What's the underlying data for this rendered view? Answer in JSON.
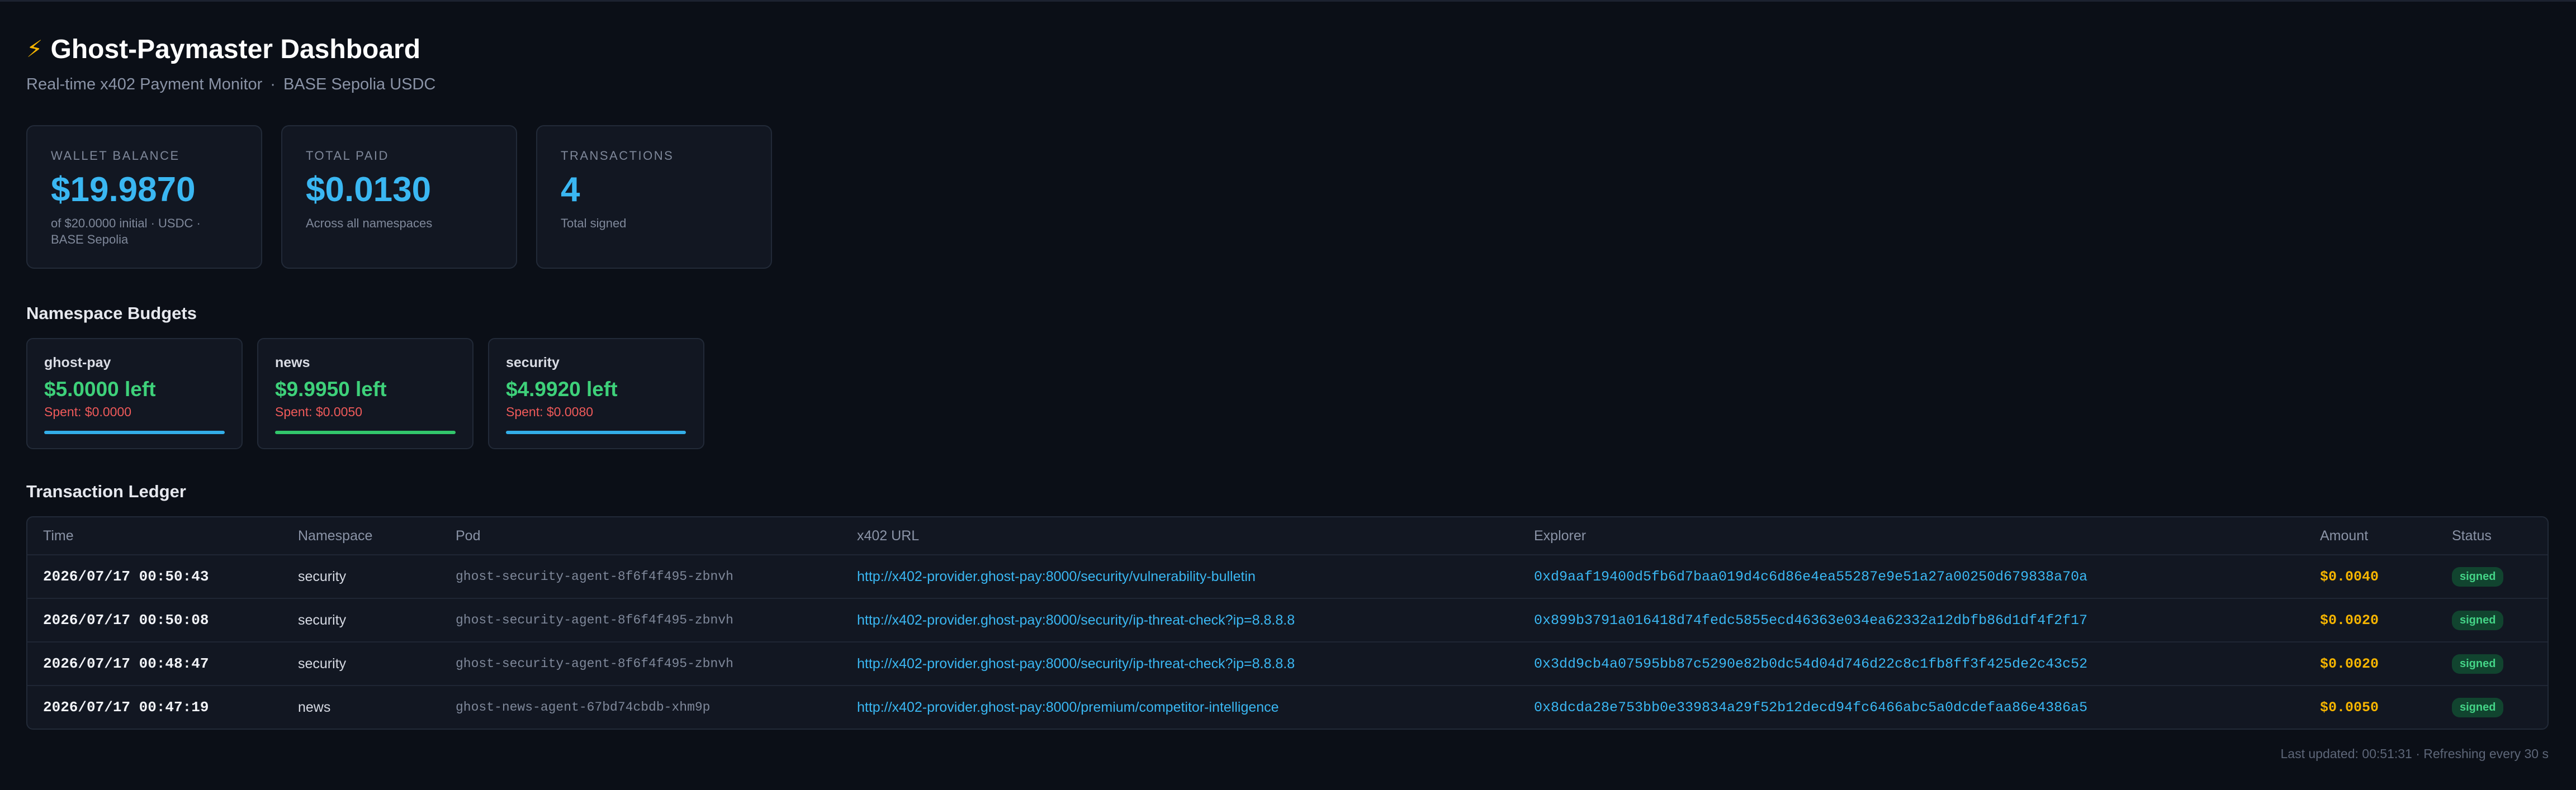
{
  "header": {
    "title": "Ghost-Paymaster Dashboard",
    "subtitle_left": "Real-time x402 Payment Monitor",
    "subtitle_sep": "·",
    "subtitle_right": "BASE Sepolia USDC"
  },
  "stats": [
    {
      "label": "Wallet Balance",
      "value": "$19.9870",
      "note": "of $20.0000 initial · USDC · BASE Sepolia"
    },
    {
      "label": "Total Paid",
      "value": "$0.0130",
      "note": "Across all namespaces"
    },
    {
      "label": "Transactions",
      "value": "4",
      "note": "Total signed"
    }
  ],
  "budgets_title": "Namespace Budgets",
  "budgets": [
    {
      "name": "ghost-pay",
      "left": "$5.0000 left",
      "spent": "Spent: $0.0000",
      "remaining_fraction": 1.0,
      "bar_color": "#33aee8"
    },
    {
      "name": "news",
      "left": "$9.9950 left",
      "spent": "Spent: $0.0050",
      "remaining_fraction": 0.9995,
      "bar_color": "#32c66b"
    },
    {
      "name": "security",
      "left": "$4.9920 left",
      "spent": "Spent: $0.0080",
      "remaining_fraction": 0.9984,
      "bar_color": "#33aee8"
    }
  ],
  "ledger_title": "Transaction Ledger",
  "ledger": {
    "columns": [
      "Time",
      "Namespace",
      "Pod",
      "x402 URL",
      "Explorer",
      "Amount",
      "Status"
    ],
    "rows": [
      {
        "time": "2026/07/17 00:50:43",
        "namespace": "security",
        "pod": "ghost-security-agent-8f6f4f495-zbnvh",
        "url": "http://x402-provider.ghost-pay:8000/security/vulnerability-bulletin",
        "explorer": "0xd9aaf19400d5fb6d7baa019d4c6d86e4ea55287e9e51a27a00250d679838a70a",
        "amount": "$0.0040",
        "status": "signed"
      },
      {
        "time": "2026/07/17 00:50:08",
        "namespace": "security",
        "pod": "ghost-security-agent-8f6f4f495-zbnvh",
        "url": "http://x402-provider.ghost-pay:8000/security/ip-threat-check?ip=8.8.8.8",
        "explorer": "0x899b3791a016418d74fedc5855ecd46363e034ea62332a12dbfb86d1df4f2f17",
        "amount": "$0.0020",
        "status": "signed"
      },
      {
        "time": "2026/07/17 00:48:47",
        "namespace": "security",
        "pod": "ghost-security-agent-8f6f4f495-zbnvh",
        "url": "http://x402-provider.ghost-pay:8000/security/ip-threat-check?ip=8.8.8.8",
        "explorer": "0x3dd9cb4a07595bb87c5290e82b0dc54d04d746d22c8c1fb8ff3f425de2c43c52",
        "amount": "$0.0020",
        "status": "signed"
      },
      {
        "time": "2026/07/17 00:47:19",
        "namespace": "news",
        "pod": "ghost-news-agent-67bd74cbdb-xhm9p",
        "url": "http://x402-provider.ghost-pay:8000/premium/competitor-intelligence",
        "explorer": "0x8dcda28e753bb0e339834a29f52b12decd94fc6466abc5a0dcdefaa86e4386a5",
        "amount": "$0.0050",
        "status": "signed"
      }
    ]
  },
  "footer": "Last updated: 00:51:31 · Refreshing every 30 s"
}
